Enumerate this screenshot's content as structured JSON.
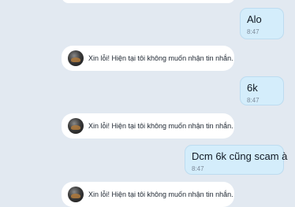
{
  "messages": [
    {
      "type": "sent",
      "text": "Alo",
      "time": "8:47"
    },
    {
      "type": "system",
      "text": "Xin lỗi! Hiện tại tôi không muốn nhận tin nhắn."
    },
    {
      "type": "sent",
      "text": "6k",
      "time": "8:47"
    },
    {
      "type": "system",
      "text": "Xin lỗi! Hiện tại tôi không muốn nhận tin nhắn."
    },
    {
      "type": "sent",
      "text": "Dcm 6k cũng scam à",
      "time": "8:47"
    },
    {
      "type": "system",
      "text": "Xin lỗi! Hiện tại tôi không muốn nhận tin nhắn."
    }
  ]
}
